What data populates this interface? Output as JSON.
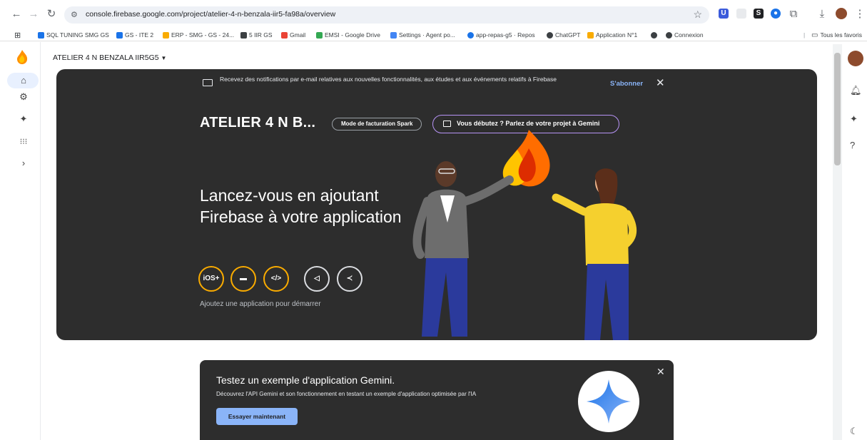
{
  "browser": {
    "url": "console.firebase.google.com/project/atelier-4-n-benzala-iir5-fa98a/overview",
    "bookmarks": [
      {
        "label": "SQL TUNING SMG GS",
        "color": "#1a73e8"
      },
      {
        "label": "GS - ITE 2",
        "color": "#1a73e8"
      },
      {
        "label": "ERP - SMG - GS - 24...",
        "color": "#f9ab00"
      },
      {
        "label": "5 IIR GS",
        "color": "#3c4043"
      },
      {
        "label": "Gmail",
        "color": "#ea4335"
      },
      {
        "label": "EMSI - Google Drive",
        "color": "#34a853"
      },
      {
        "label": "Settings · Agent po...",
        "color": "#4285f4"
      },
      {
        "label": "app-repas-g5 · Repos",
        "color": "#1a73e8"
      },
      {
        "label": "ChatGPT",
        "color": "#3c4043"
      },
      {
        "label": "Application N°1",
        "color": "#f9ab00"
      },
      {
        "label": "",
        "color": "#3c4043"
      },
      {
        "label": "Connexion",
        "color": "#3c4043"
      }
    ],
    "all_bookmarks_label": "Tous les favoris"
  },
  "console": {
    "project_name": "ATELIER 4 N BENZALA IIR5G5",
    "notification": {
      "text": "Recevez des notifications par e-mail relatives aux nouvelles fonctionnalités, aux études et aux événements relatifs à Firebase",
      "subscribe_label": "S'abonner",
      "close_label": "✕"
    },
    "project_title": "ATELIER 4 N B...",
    "billing_label": "Mode de facturation Spark",
    "gemini_pill_label": "Vous débutez ? Parlez de votre projet à Gemini",
    "headline": "Lancez-vous en ajoutant Firebase à votre application",
    "app_buttons": [
      {
        "label": "iOS+",
        "icon": "ios-icon"
      },
      {
        "label": "▬",
        "icon": "android-icon"
      },
      {
        "label": "</>",
        "icon": "web-icon"
      },
      {
        "label": "◁",
        "icon": "unity-icon"
      },
      {
        "label": "≺",
        "icon": "flutter-icon"
      }
    ],
    "add_app_hint": "Ajoutez une application pour démarrer",
    "gemini_card": {
      "title": "Testez un exemple d'application Gemini.",
      "description": "Découvrez l'API Gemini et son fonctionnement en testant un exemple d'application optimisée par l'IA",
      "button_label": "Essayer maintenant",
      "close_label": "✕"
    }
  },
  "colors": {
    "hero_bg": "#2d2d2d",
    "accent_orange": "#f9ab00",
    "link_blue": "#8ab4f8"
  }
}
